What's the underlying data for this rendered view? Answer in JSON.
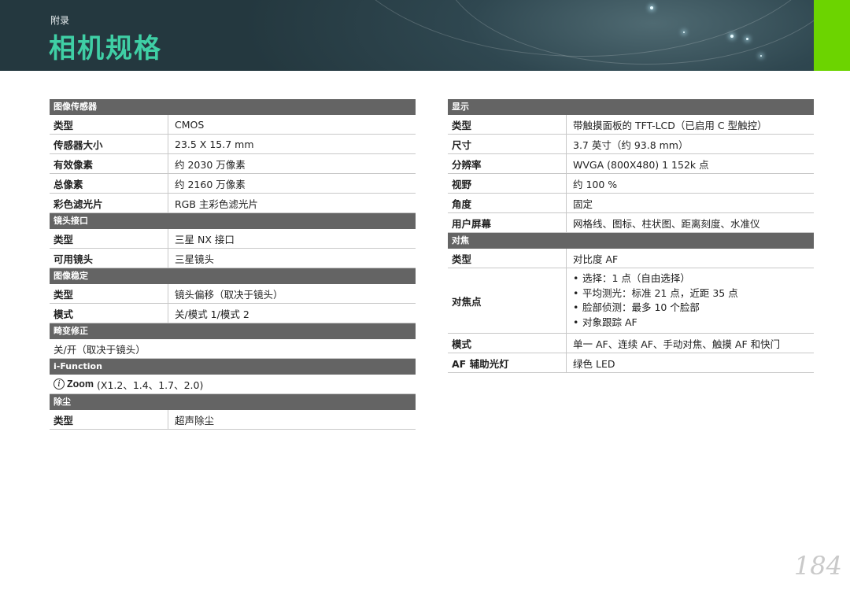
{
  "header": {
    "subtitle": "附录",
    "title": "相机规格"
  },
  "left": {
    "image_sensor": {
      "heading": "图像传感器",
      "rows": [
        {
          "k": "类型",
          "v": "CMOS"
        },
        {
          "k": "传感器大小",
          "v": "23.5 X 15.7 mm"
        },
        {
          "k": "有效像素",
          "v": "约 2030 万像素"
        },
        {
          "k": "总像素",
          "v": "约 2160 万像素"
        },
        {
          "k": "彩色滤光片",
          "v": "RGB 主彩色滤光片"
        }
      ]
    },
    "lens_mount": {
      "heading": "镜头接口",
      "rows": [
        {
          "k": "类型",
          "v": "三星 NX 接口"
        },
        {
          "k": "可用镜头",
          "v": "三星镜头"
        }
      ]
    },
    "stabilization": {
      "heading": "图像稳定",
      "rows": [
        {
          "k": "类型",
          "v": "镜头偏移（取决于镜头）"
        },
        {
          "k": "模式",
          "v": "关/模式 1/模式 2"
        }
      ]
    },
    "distortion": {
      "heading": "畸变修正",
      "value": "关/开（取决于镜头）"
    },
    "ifunction": {
      "heading": "i-Function",
      "zoom_label": "Zoom",
      "value": "(X1.2、1.4、1.7、2.0)"
    },
    "dust": {
      "heading": "除尘",
      "rows": [
        {
          "k": "类型",
          "v": "超声除尘"
        }
      ]
    }
  },
  "right": {
    "display": {
      "heading": "显示",
      "rows": [
        {
          "k": "类型",
          "v": "带触摸面板的 TFT-LCD（已启用 C 型触控）"
        },
        {
          "k": "尺寸",
          "v": "3.7 英寸（约 93.8 mm）"
        },
        {
          "k": "分辨率",
          "v": "WVGA (800X480) 1 152k 点"
        },
        {
          "k": "视野",
          "v": "约 100 %"
        },
        {
          "k": "角度",
          "v": "固定"
        },
        {
          "k": "用户屏幕",
          "v": "网格线、图标、柱状图、距离刻度、水准仪"
        }
      ]
    },
    "focus": {
      "heading": "对焦",
      "type_k": "类型",
      "type_v": "对比度 AF",
      "point_k": "对焦点",
      "point_items": [
        "选择：1 点（自由选择）",
        "平均测光：标准 21 点，近距 35 点",
        "脸部侦测：最多 10 个脸部",
        "对象跟踪 AF"
      ],
      "mode_k": "模式",
      "mode_v": "单一 AF、连续 AF、手动对焦、触摸 AF 和快门",
      "assist_k": "AF 辅助光灯",
      "assist_v": "绿色 LED"
    }
  },
  "page_number": "184"
}
